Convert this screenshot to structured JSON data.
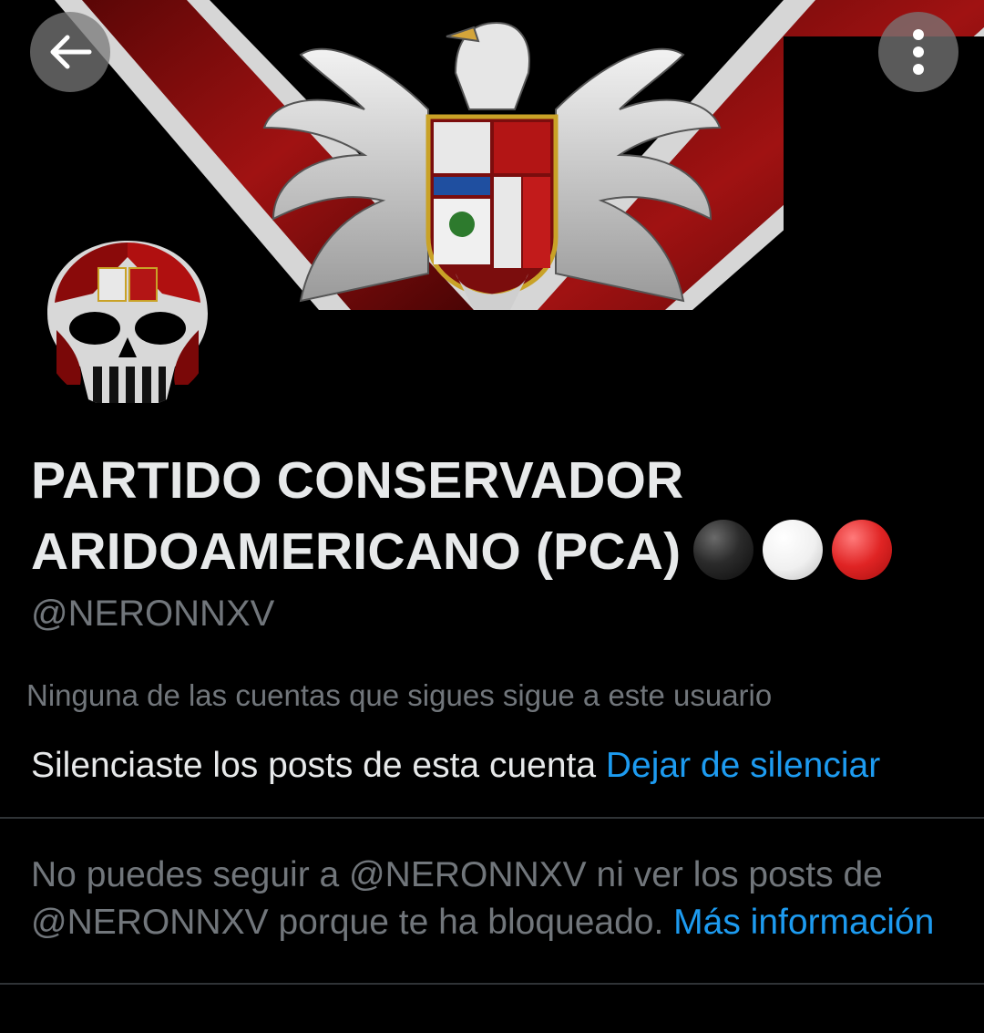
{
  "header": {
    "back_icon": "arrow-left-icon",
    "more_icon": "vertical-ellipsis-icon"
  },
  "banner": {
    "description_icon": "eagle-coat-of-arms-banner",
    "colors": {
      "stripe_red": "#8e0d0d",
      "stripe_white": "#d9d9d9",
      "background": "#000000"
    }
  },
  "profile": {
    "name_line1": "PARTIDO CONSERVADOR",
    "name_line2": "ARIDOAMERICANO (PCA)",
    "name_emojis": [
      "black-circle-emoji",
      "white-circle-emoji",
      "red-circle-emoji"
    ],
    "handle": "@NERONNXV",
    "followers_note": "Ninguna de las cuentas que sigues sigue a este usuario",
    "muted_text": "Silenciaste los posts de esta cuenta",
    "unmute_link": "Dejar de silenciar",
    "blocked_text_line1": "No puedes seguir a @NERONNXV ni ver los posts de",
    "blocked_text_line2": "@NERONNXV porque te ha bloqueado.",
    "more_info_link": "Más información"
  },
  "colors": {
    "link": "#1d9bf0",
    "primary_text": "#e7e9ea",
    "secondary_text": "#71767b",
    "divider": "#2f3336"
  }
}
